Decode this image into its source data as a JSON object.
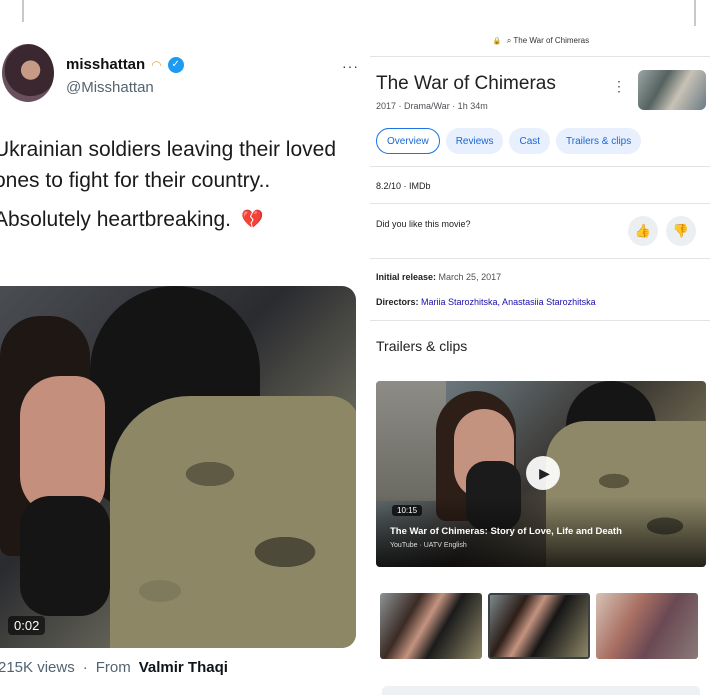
{
  "tweet": {
    "display_name": "misshattan",
    "handle": "@Misshattan",
    "more_label": "···",
    "text_line1": "Ukrainian soldiers leaving their loved ones to fight for their country..",
    "text_line2": "Absolutely heartbreaking.",
    "heart_glyph": "💔",
    "video_time": "0:02",
    "views": "215K views",
    "dot": "·",
    "from_label": "From",
    "from_name": "Valmir Thaqi",
    "accent": "#1d9bf0"
  },
  "panel": {
    "url": "The War of Chimeras",
    "title": "The War of Chimeras",
    "more_icon": "⋮",
    "meta": "2017 · Drama/War · 1h 34m",
    "tabs": [
      "Overview",
      "Reviews",
      "Cast",
      "Trailers & clips"
    ],
    "rating": "8.2/10 · IMDb",
    "like_question": "Did you like this movie?",
    "thumbs_up": "👍",
    "thumbs_down": "👎",
    "release_label": "Initial release:",
    "release_value": "March 25, 2017",
    "directors_label": "Directors:",
    "directors_value": "Mariia Starozhitska, Anastasiia Starozhitska",
    "trailers_heading": "Trailers & clips",
    "clip": {
      "duration": "10:15",
      "title": "The War of Chimeras: Story of Love, Life and Death",
      "source": "YouTube · UATV English"
    },
    "accent": "#1a73e8"
  }
}
